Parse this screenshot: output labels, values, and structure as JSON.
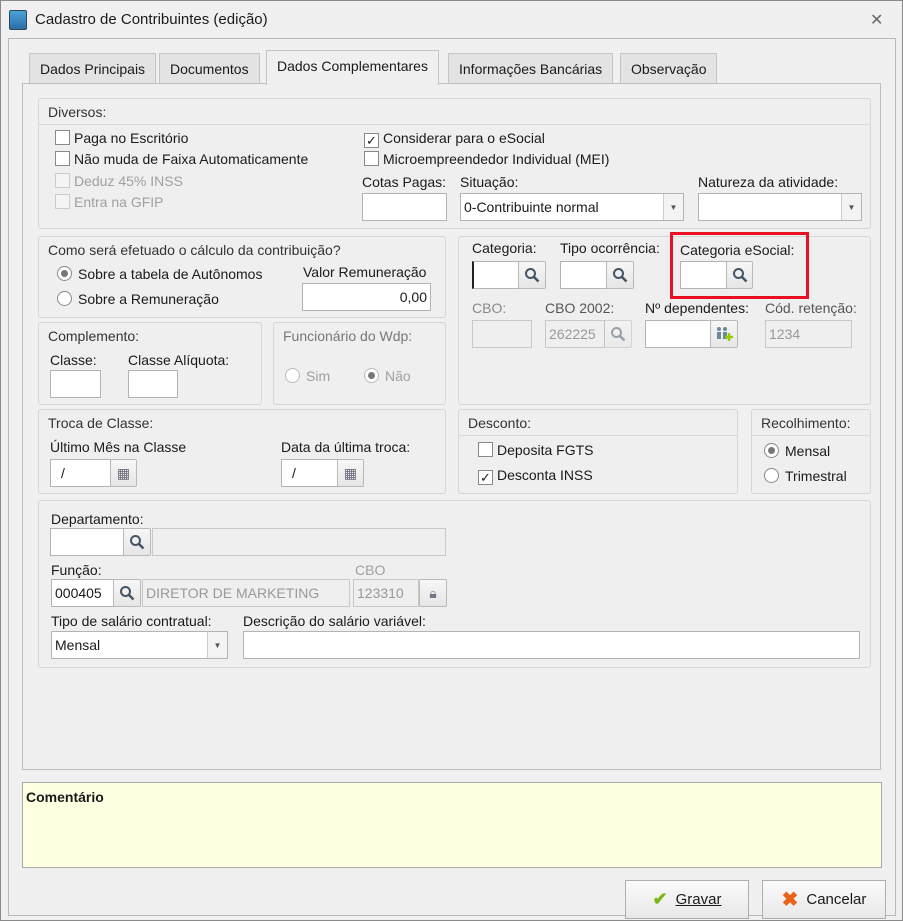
{
  "window": {
    "title": "Cadastro de Contribuintes (edição)",
    "close_icon": "✕"
  },
  "tabs": [
    {
      "label": "Dados Principais"
    },
    {
      "label": "Documentos"
    },
    {
      "label": "Dados Complementares",
      "active": true
    },
    {
      "label": "Informações Bancárias"
    },
    {
      "label": "Observação"
    }
  ],
  "diversos": {
    "title": "Diversos:",
    "checks": [
      {
        "label": "Paga no Escritório",
        "checked": false
      },
      {
        "label": "Não muda de Faixa Automaticamente",
        "checked": false
      },
      {
        "label": "Deduz 45% INSS",
        "checked": false,
        "disabled": true
      },
      {
        "label": "Entra na GFIP",
        "checked": false,
        "disabled": true
      },
      {
        "label": "Considerar para o eSocial",
        "checked": true
      },
      {
        "label": "Microempreendedor Individual (MEI)",
        "checked": false
      }
    ],
    "cotas_label": "Cotas Pagas:",
    "cotas_value": "",
    "situacao_label": "Situação:",
    "situacao_value": "0-Contribuinte normal",
    "natureza_label": "Natureza da atividade:",
    "natureza_value": ""
  },
  "calculo": {
    "title": "Como será efetuado o cálculo da contribuição?",
    "options": [
      "Sobre a tabela de Autônomos",
      "Sobre a Remuneração"
    ],
    "selected": 0,
    "valor_label": "Valor Remuneração",
    "valor_value": "0,00"
  },
  "complemento": {
    "title": "Complemento:",
    "classe_label": "Classe:",
    "classe_value": "",
    "aliquota_label": "Classe Alíquota:",
    "aliquota_value": ""
  },
  "wdp": {
    "title": "Funcionário do Wdp:",
    "options": [
      "Sim",
      "Não"
    ],
    "selected": 1
  },
  "categoria": {
    "categoria_label": "Categoria:",
    "categoria_value": "",
    "tipo_label": "Tipo ocorrência:",
    "tipo_value": "",
    "esocial_label": "Categoria eSocial:",
    "esocial_value": "",
    "cbo_label": "CBO:",
    "cbo_value": "",
    "cbo2002_label": "CBO 2002:",
    "cbo2002_value": "262225",
    "dependentes_label": "Nº dependentes:",
    "dependentes_value": "",
    "retencao_label": "Cód. retenção:",
    "retencao_value": "1234"
  },
  "troca": {
    "title": "Troca de Classe:",
    "ultimo_label": "Último Mês na Classe",
    "ultimo_value": "/",
    "data_label": "Data da última troca:",
    "data_value": "/"
  },
  "desconto": {
    "title": "Desconto:",
    "checks": [
      {
        "label": "Deposita FGTS",
        "checked": false
      },
      {
        "label": "Desconta INSS",
        "checked": true
      }
    ]
  },
  "recolhimento": {
    "title": "Recolhimento:",
    "options": [
      "Mensal",
      "Trimestral"
    ],
    "selected": 0
  },
  "funcao": {
    "departamento_label": "Departamento:",
    "departamento_code": "",
    "departamento_desc": "",
    "funcao_label": "Função:",
    "funcao_code": "000405",
    "funcao_desc": "DIRETOR DE MARKETING",
    "cbo_label": "CBO",
    "cbo_value": "123310",
    "tipo_label": "Tipo de salário contratual:",
    "tipo_value": "Mensal",
    "descricao_label": "Descrição do salário variável:",
    "descricao_value": ""
  },
  "comentario": {
    "label": "Comentário"
  },
  "buttons": {
    "gravar": "Gravar",
    "cancelar": "Cancelar"
  },
  "colors": {
    "highlight": "#e81123",
    "comment_bg": "#ffffe1",
    "check_green": "#7cb518",
    "cancel_orange": "#e8641a"
  }
}
